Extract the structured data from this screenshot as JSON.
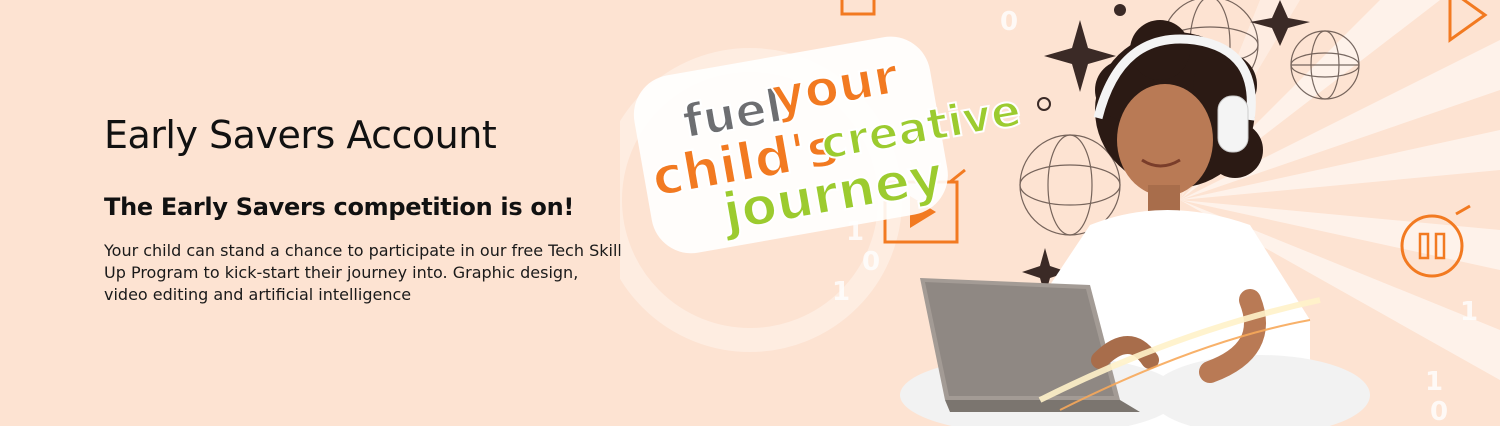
{
  "hero": {
    "title": "Early Savers Account",
    "subtitle": "The Early Savers competition is on!",
    "body": "Your child can stand a chance to  participate in our free Tech Skill Up Program to kick-start their journey into. Graphic design, video editing and artificial intelligence"
  },
  "logo": {
    "line1a": "fuel",
    "line1b": "your",
    "line2a": "child's",
    "line2b": "creative",
    "line3": "journey"
  },
  "colors": {
    "background": "#fde3d2",
    "orange": "#f27a21",
    "green": "#9ccb2f",
    "grey": "#6d6e71"
  },
  "icons": [
    "play-icon",
    "pause-icon",
    "wireframe-globe-icon",
    "sparkle-icon",
    "laptop-icon",
    "headphones-icon"
  ]
}
